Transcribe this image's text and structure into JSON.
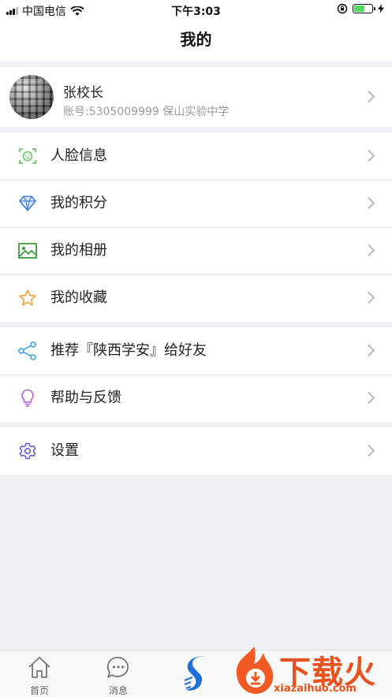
{
  "status_bar": {
    "carrier": "中国电信",
    "time": "下午3:03",
    "battery_level": 0.55
  },
  "nav": {
    "title": "我的"
  },
  "profile": {
    "name": "张校长",
    "account": "账号:5305009999 保山实验中学"
  },
  "menu_groups": [
    {
      "items": [
        {
          "label": "人脸信息",
          "icon": "face-scan-icon",
          "color": "#5cb85c"
        },
        {
          "label": "我的积分",
          "icon": "diamond-icon",
          "color": "#4a7fd6"
        },
        {
          "label": "我的相册",
          "icon": "image-icon",
          "color": "#3c9d3c"
        },
        {
          "label": "我的收藏",
          "icon": "star-icon",
          "color": "#e8a43a"
        }
      ]
    },
    {
      "items": [
        {
          "label": "推荐『陕西学安』给好友",
          "icon": "share-icon",
          "color": "#3aa0e0"
        },
        {
          "label": "帮助与反馈",
          "icon": "lightbulb-icon",
          "color": "#b45ad6"
        }
      ]
    },
    {
      "items": [
        {
          "label": "设置",
          "icon": "gear-icon",
          "color": "#5a5ac8"
        }
      ]
    }
  ],
  "tabbar": {
    "tabs": [
      {
        "label": "首页",
        "icon": "home-icon"
      },
      {
        "label": "消息",
        "icon": "chat-icon"
      },
      {
        "label": "",
        "icon": "app-logo-icon"
      }
    ]
  },
  "watermark": {
    "text": "下载火",
    "url": "xiazaihuo.com"
  }
}
